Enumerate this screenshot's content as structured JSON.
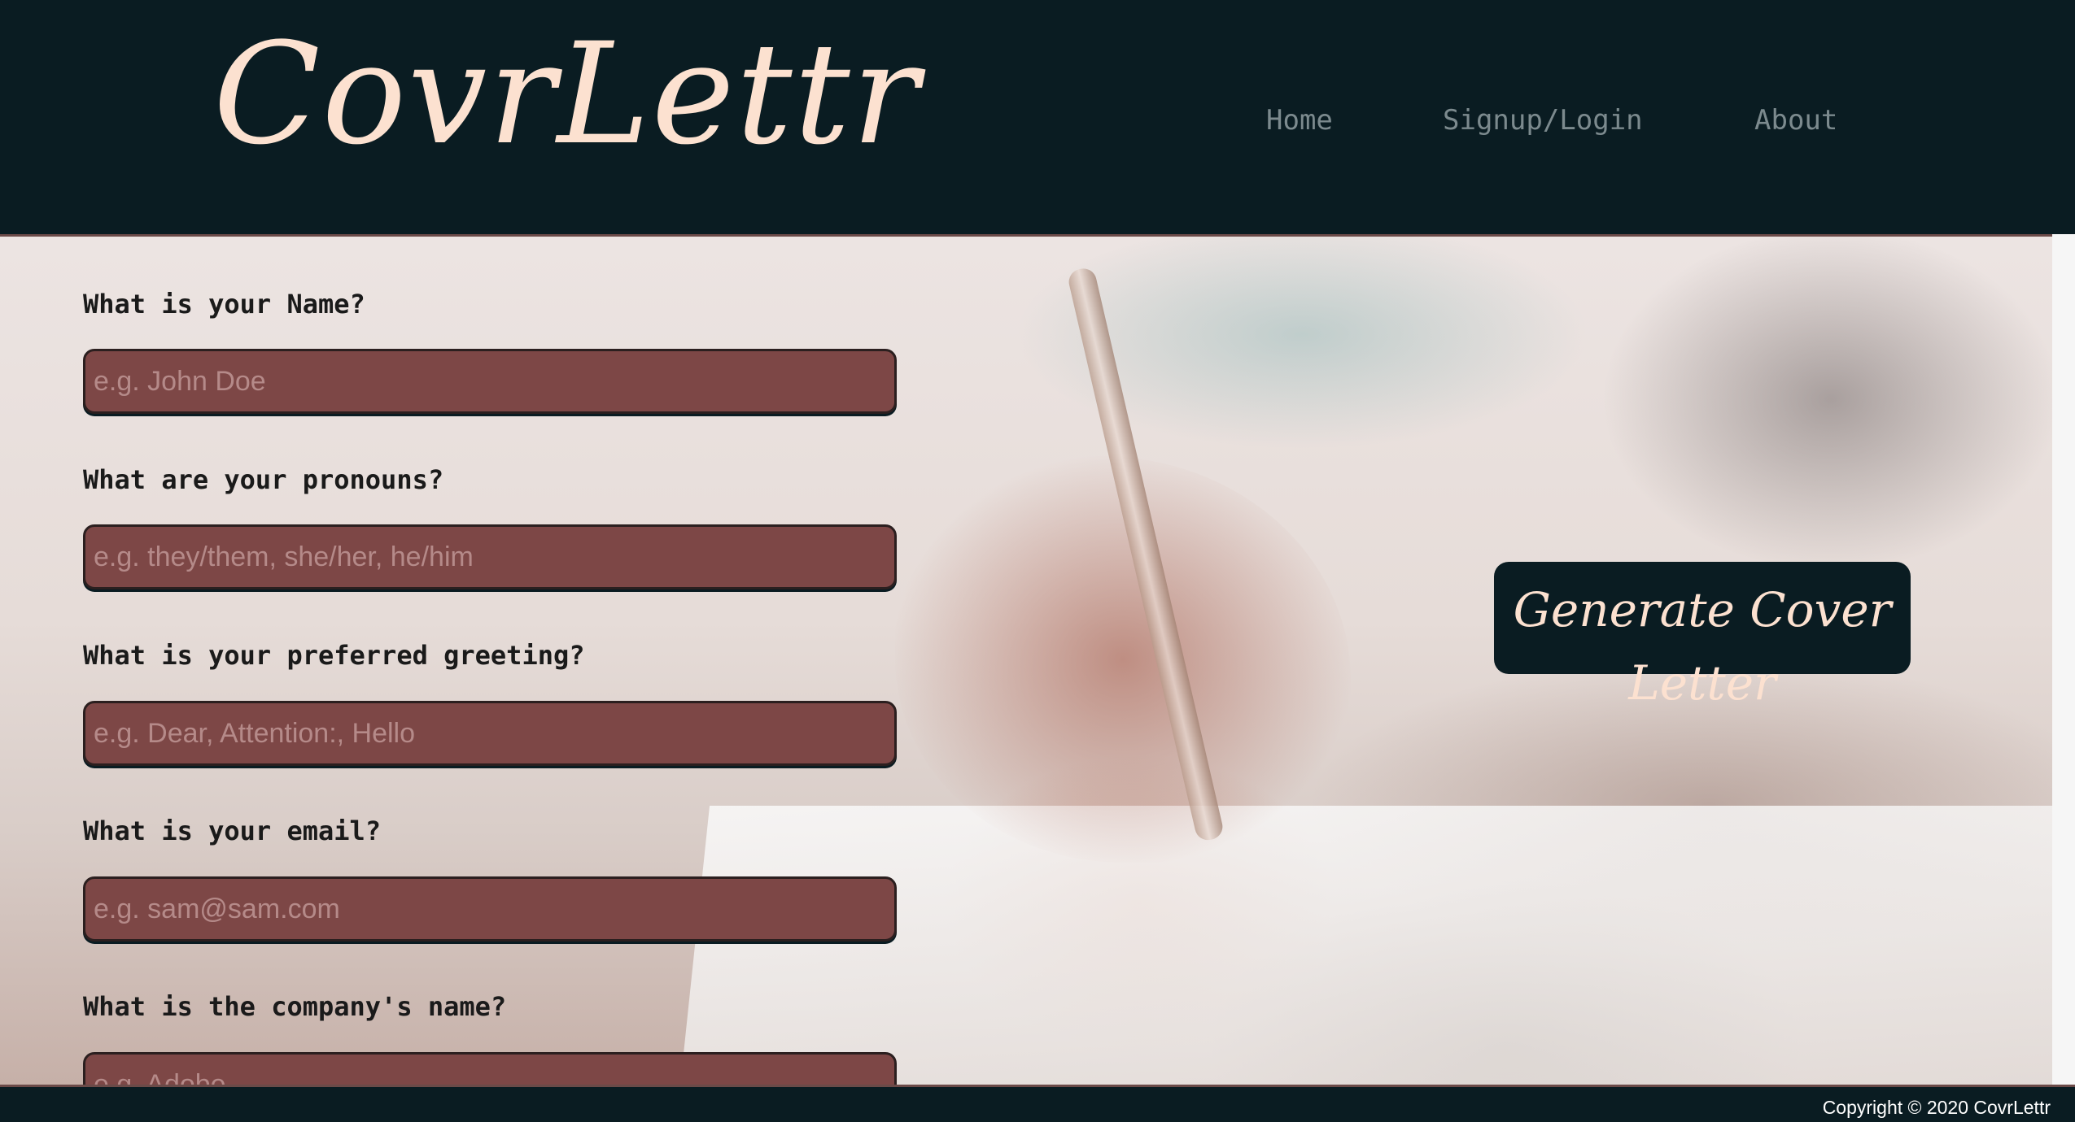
{
  "header": {
    "logo": "CovrLettr",
    "nav": {
      "home": "Home",
      "signup_login": "Signup/Login",
      "about": "About"
    }
  },
  "form": {
    "fields": [
      {
        "label": "What is your Name?",
        "placeholder": "e.g. John Doe",
        "value": ""
      },
      {
        "label": "What are your pronouns?",
        "placeholder": "e.g. they/them, she/her, he/him",
        "value": ""
      },
      {
        "label": "What is your preferred greeting?",
        "placeholder": "e.g. Dear, Attention:, Hello",
        "value": ""
      },
      {
        "label": "What is your email?",
        "placeholder": "e.g. sam@sam.com",
        "value": ""
      },
      {
        "label": "What is the company's name?",
        "placeholder": "e.g. Adobe",
        "value": ""
      }
    ]
  },
  "generate_button": {
    "label_line1": "Generate Cover",
    "label_line2": "Letter"
  },
  "footer": {
    "copyright": "Copyright © 2020 CovrLettr"
  },
  "colors": {
    "header_bg": "#0a1c22",
    "logo": "#fce1d0",
    "nav_link": "#7c8a8e",
    "input_bg": "#7d4746",
    "button_bg": "#0a1c22"
  }
}
